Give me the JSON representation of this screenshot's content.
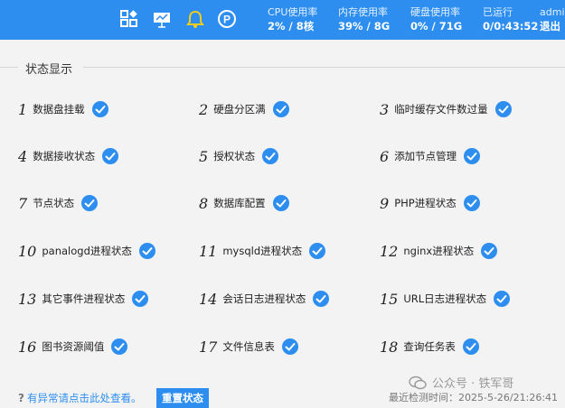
{
  "topbar": {
    "icons": [
      "apps-icon",
      "presentation-board-icon",
      "bell-icon",
      "parking-p-icon"
    ],
    "cpu": {
      "label": "CPU使用率",
      "value": "2% / 8核"
    },
    "mem": {
      "label": "内存使用率",
      "value": "39% / 8G"
    },
    "disk": {
      "label": "硬盘使用率",
      "value": "0% / 71G"
    },
    "uptime": {
      "label": "已运行",
      "value": "0/0:43:52"
    },
    "user": {
      "label": "admin",
      "logout": "退出"
    },
    "colors": {
      "bar": "#2d8ef0",
      "bell": "#f4cc1a"
    }
  },
  "section": {
    "title": "状态显示"
  },
  "items": [
    {
      "num": "1",
      "name": "数据盘挂载"
    },
    {
      "num": "2",
      "name": "硬盘分区满"
    },
    {
      "num": "3",
      "name": "临时缓存文件数过量"
    },
    {
      "num": "4",
      "name": "数据接收状态"
    },
    {
      "num": "5",
      "name": "授权状态"
    },
    {
      "num": "6",
      "name": "添加节点管理"
    },
    {
      "num": "7",
      "name": "节点状态"
    },
    {
      "num": "8",
      "name": "数据库配置"
    },
    {
      "num": "9",
      "name": "PHP进程状态"
    },
    {
      "num": "10",
      "name": "panalogd进程状态"
    },
    {
      "num": "11",
      "name": "mysqld进程状态"
    },
    {
      "num": "12",
      "name": "nginx进程状态"
    },
    {
      "num": "13",
      "name": "其它事件进程状态"
    },
    {
      "num": "14",
      "name": "会话日志进程状态"
    },
    {
      "num": "15",
      "name": "URL日志进程状态"
    },
    {
      "num": "16",
      "name": "图书资源阈值"
    },
    {
      "num": "17",
      "name": "文件信息表"
    },
    {
      "num": "18",
      "name": "查询任务表"
    }
  ],
  "status_color": "#2d8ef0",
  "footer": {
    "help_icon": "?",
    "help_text": "有异常请点击此处查看。",
    "reset_label": "重置状态",
    "watermark": "公众号 · 铁军哥",
    "last_check": "最近检测时间：2025-5-26/21:26:41"
  }
}
